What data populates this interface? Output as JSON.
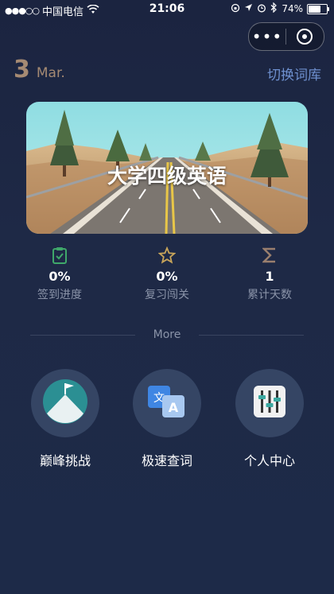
{
  "status_bar": {
    "carrier": "中国电信",
    "time": "21:06",
    "battery": "74%",
    "battery_level": 0.74
  },
  "capsule": {
    "more_icon": "more-dots-icon",
    "close_icon": "target-circle-icon"
  },
  "header": {
    "day": "3",
    "month": "Mar.",
    "switch_label": "切换词库"
  },
  "banner": {
    "title": "大学四级英语"
  },
  "stats": [
    {
      "icon": "clipboard-check-icon",
      "value": "0%",
      "label": "签到进度",
      "color": "#3fa86a"
    },
    {
      "icon": "star-outline-icon",
      "value": "0%",
      "label": "复习闯关",
      "color": "#c9a55a"
    },
    {
      "icon": "sigma-icon",
      "value": "1",
      "label": "累计天数",
      "color": "#9a7f6e"
    }
  ],
  "divider": {
    "label": "More"
  },
  "features": [
    {
      "icon": "mountain-flag-icon",
      "label": "巅峰挑战"
    },
    {
      "icon": "translate-icon",
      "label": "极速查词"
    },
    {
      "icon": "sliders-icon",
      "label": "个人中心"
    }
  ]
}
